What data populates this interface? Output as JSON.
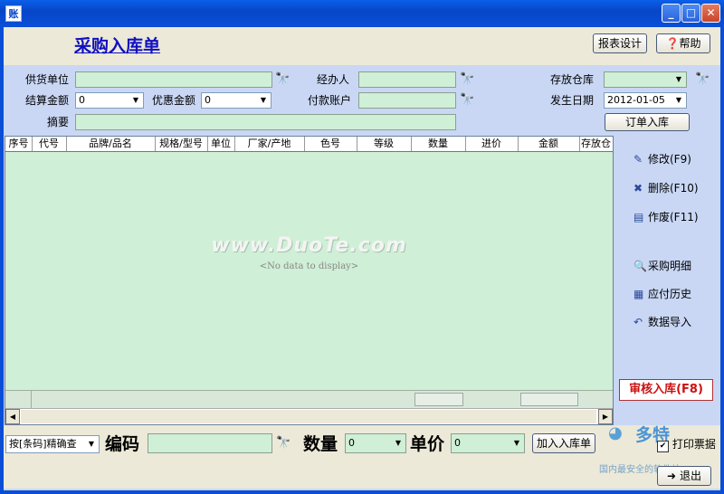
{
  "window": {
    "app_icon": "账"
  },
  "header": {
    "title": "采购入库单",
    "report_design": "报表设计",
    "help": "帮助"
  },
  "form": {
    "supplier_label": "供货单位",
    "handler_label": "经办人",
    "warehouse_label": "存放仓库",
    "settle_label": "结算金额",
    "settle_value": "0",
    "discount_label": "优惠金额",
    "discount_value": "0",
    "account_label": "付款账户",
    "date_label": "发生日期",
    "date_value": "2012-01-05",
    "memo_label": "摘要",
    "order_in_button": "订单入库"
  },
  "grid": {
    "columns": [
      "序号",
      "代号",
      "品牌/品名",
      "规格/型号",
      "单位",
      "厂家/产地",
      "色号",
      "等级",
      "数量",
      "进价",
      "金额",
      "存放仓"
    ],
    "empty_text": "<No data to display>",
    "watermark": "www.DuoTe.com"
  },
  "right_panel": {
    "edit": "修改(F9)",
    "delete": "删除(F10)",
    "void": "作废(F11)",
    "purchase_detail": "采购明细",
    "payable_history": "应付历史",
    "data_import": "数据导入",
    "audit": "审核入库(F8)"
  },
  "bottom": {
    "search_mode": "按[条码]精确查",
    "code_label": "编码",
    "qty_label": "数量",
    "qty_value": "0",
    "price_label": "单价",
    "price_value": "0",
    "add_button": "加入入库单",
    "print_label": "打印票据",
    "exit": "退出",
    "logo_text": "多特",
    "slogan": "国内最安全的软件站"
  }
}
